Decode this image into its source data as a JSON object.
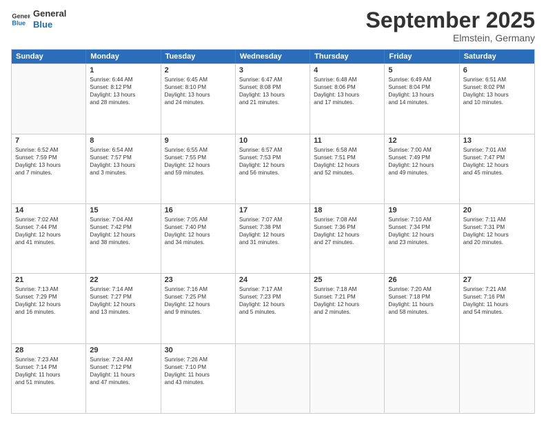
{
  "header": {
    "logo_general": "General",
    "logo_blue": "Blue",
    "month": "September 2025",
    "location": "Elmstein, Germany"
  },
  "days_of_week": [
    "Sunday",
    "Monday",
    "Tuesday",
    "Wednesday",
    "Thursday",
    "Friday",
    "Saturday"
  ],
  "weeks": [
    [
      {
        "day": "",
        "lines": []
      },
      {
        "day": "1",
        "lines": [
          "Sunrise: 6:44 AM",
          "Sunset: 8:12 PM",
          "Daylight: 13 hours",
          "and 28 minutes."
        ]
      },
      {
        "day": "2",
        "lines": [
          "Sunrise: 6:45 AM",
          "Sunset: 8:10 PM",
          "Daylight: 13 hours",
          "and 24 minutes."
        ]
      },
      {
        "day": "3",
        "lines": [
          "Sunrise: 6:47 AM",
          "Sunset: 8:08 PM",
          "Daylight: 13 hours",
          "and 21 minutes."
        ]
      },
      {
        "day": "4",
        "lines": [
          "Sunrise: 6:48 AM",
          "Sunset: 8:06 PM",
          "Daylight: 13 hours",
          "and 17 minutes."
        ]
      },
      {
        "day": "5",
        "lines": [
          "Sunrise: 6:49 AM",
          "Sunset: 8:04 PM",
          "Daylight: 13 hours",
          "and 14 minutes."
        ]
      },
      {
        "day": "6",
        "lines": [
          "Sunrise: 6:51 AM",
          "Sunset: 8:02 PM",
          "Daylight: 13 hours",
          "and 10 minutes."
        ]
      }
    ],
    [
      {
        "day": "7",
        "lines": [
          "Sunrise: 6:52 AM",
          "Sunset: 7:59 PM",
          "Daylight: 13 hours",
          "and 7 minutes."
        ]
      },
      {
        "day": "8",
        "lines": [
          "Sunrise: 6:54 AM",
          "Sunset: 7:57 PM",
          "Daylight: 13 hours",
          "and 3 minutes."
        ]
      },
      {
        "day": "9",
        "lines": [
          "Sunrise: 6:55 AM",
          "Sunset: 7:55 PM",
          "Daylight: 12 hours",
          "and 59 minutes."
        ]
      },
      {
        "day": "10",
        "lines": [
          "Sunrise: 6:57 AM",
          "Sunset: 7:53 PM",
          "Daylight: 12 hours",
          "and 56 minutes."
        ]
      },
      {
        "day": "11",
        "lines": [
          "Sunrise: 6:58 AM",
          "Sunset: 7:51 PM",
          "Daylight: 12 hours",
          "and 52 minutes."
        ]
      },
      {
        "day": "12",
        "lines": [
          "Sunrise: 7:00 AM",
          "Sunset: 7:49 PM",
          "Daylight: 12 hours",
          "and 49 minutes."
        ]
      },
      {
        "day": "13",
        "lines": [
          "Sunrise: 7:01 AM",
          "Sunset: 7:47 PM",
          "Daylight: 12 hours",
          "and 45 minutes."
        ]
      }
    ],
    [
      {
        "day": "14",
        "lines": [
          "Sunrise: 7:02 AM",
          "Sunset: 7:44 PM",
          "Daylight: 12 hours",
          "and 41 minutes."
        ]
      },
      {
        "day": "15",
        "lines": [
          "Sunrise: 7:04 AM",
          "Sunset: 7:42 PM",
          "Daylight: 12 hours",
          "and 38 minutes."
        ]
      },
      {
        "day": "16",
        "lines": [
          "Sunrise: 7:05 AM",
          "Sunset: 7:40 PM",
          "Daylight: 12 hours",
          "and 34 minutes."
        ]
      },
      {
        "day": "17",
        "lines": [
          "Sunrise: 7:07 AM",
          "Sunset: 7:38 PM",
          "Daylight: 12 hours",
          "and 31 minutes."
        ]
      },
      {
        "day": "18",
        "lines": [
          "Sunrise: 7:08 AM",
          "Sunset: 7:36 PM",
          "Daylight: 12 hours",
          "and 27 minutes."
        ]
      },
      {
        "day": "19",
        "lines": [
          "Sunrise: 7:10 AM",
          "Sunset: 7:34 PM",
          "Daylight: 12 hours",
          "and 23 minutes."
        ]
      },
      {
        "day": "20",
        "lines": [
          "Sunrise: 7:11 AM",
          "Sunset: 7:31 PM",
          "Daylight: 12 hours",
          "and 20 minutes."
        ]
      }
    ],
    [
      {
        "day": "21",
        "lines": [
          "Sunrise: 7:13 AM",
          "Sunset: 7:29 PM",
          "Daylight: 12 hours",
          "and 16 minutes."
        ]
      },
      {
        "day": "22",
        "lines": [
          "Sunrise: 7:14 AM",
          "Sunset: 7:27 PM",
          "Daylight: 12 hours",
          "and 13 minutes."
        ]
      },
      {
        "day": "23",
        "lines": [
          "Sunrise: 7:16 AM",
          "Sunset: 7:25 PM",
          "Daylight: 12 hours",
          "and 9 minutes."
        ]
      },
      {
        "day": "24",
        "lines": [
          "Sunrise: 7:17 AM",
          "Sunset: 7:23 PM",
          "Daylight: 12 hours",
          "and 5 minutes."
        ]
      },
      {
        "day": "25",
        "lines": [
          "Sunrise: 7:18 AM",
          "Sunset: 7:21 PM",
          "Daylight: 12 hours",
          "and 2 minutes."
        ]
      },
      {
        "day": "26",
        "lines": [
          "Sunrise: 7:20 AM",
          "Sunset: 7:18 PM",
          "Daylight: 11 hours",
          "and 58 minutes."
        ]
      },
      {
        "day": "27",
        "lines": [
          "Sunrise: 7:21 AM",
          "Sunset: 7:16 PM",
          "Daylight: 11 hours",
          "and 54 minutes."
        ]
      }
    ],
    [
      {
        "day": "28",
        "lines": [
          "Sunrise: 7:23 AM",
          "Sunset: 7:14 PM",
          "Daylight: 11 hours",
          "and 51 minutes."
        ]
      },
      {
        "day": "29",
        "lines": [
          "Sunrise: 7:24 AM",
          "Sunset: 7:12 PM",
          "Daylight: 11 hours",
          "and 47 minutes."
        ]
      },
      {
        "day": "30",
        "lines": [
          "Sunrise: 7:26 AM",
          "Sunset: 7:10 PM",
          "Daylight: 11 hours",
          "and 43 minutes."
        ]
      },
      {
        "day": "",
        "lines": []
      },
      {
        "day": "",
        "lines": []
      },
      {
        "day": "",
        "lines": []
      },
      {
        "day": "",
        "lines": []
      }
    ]
  ]
}
